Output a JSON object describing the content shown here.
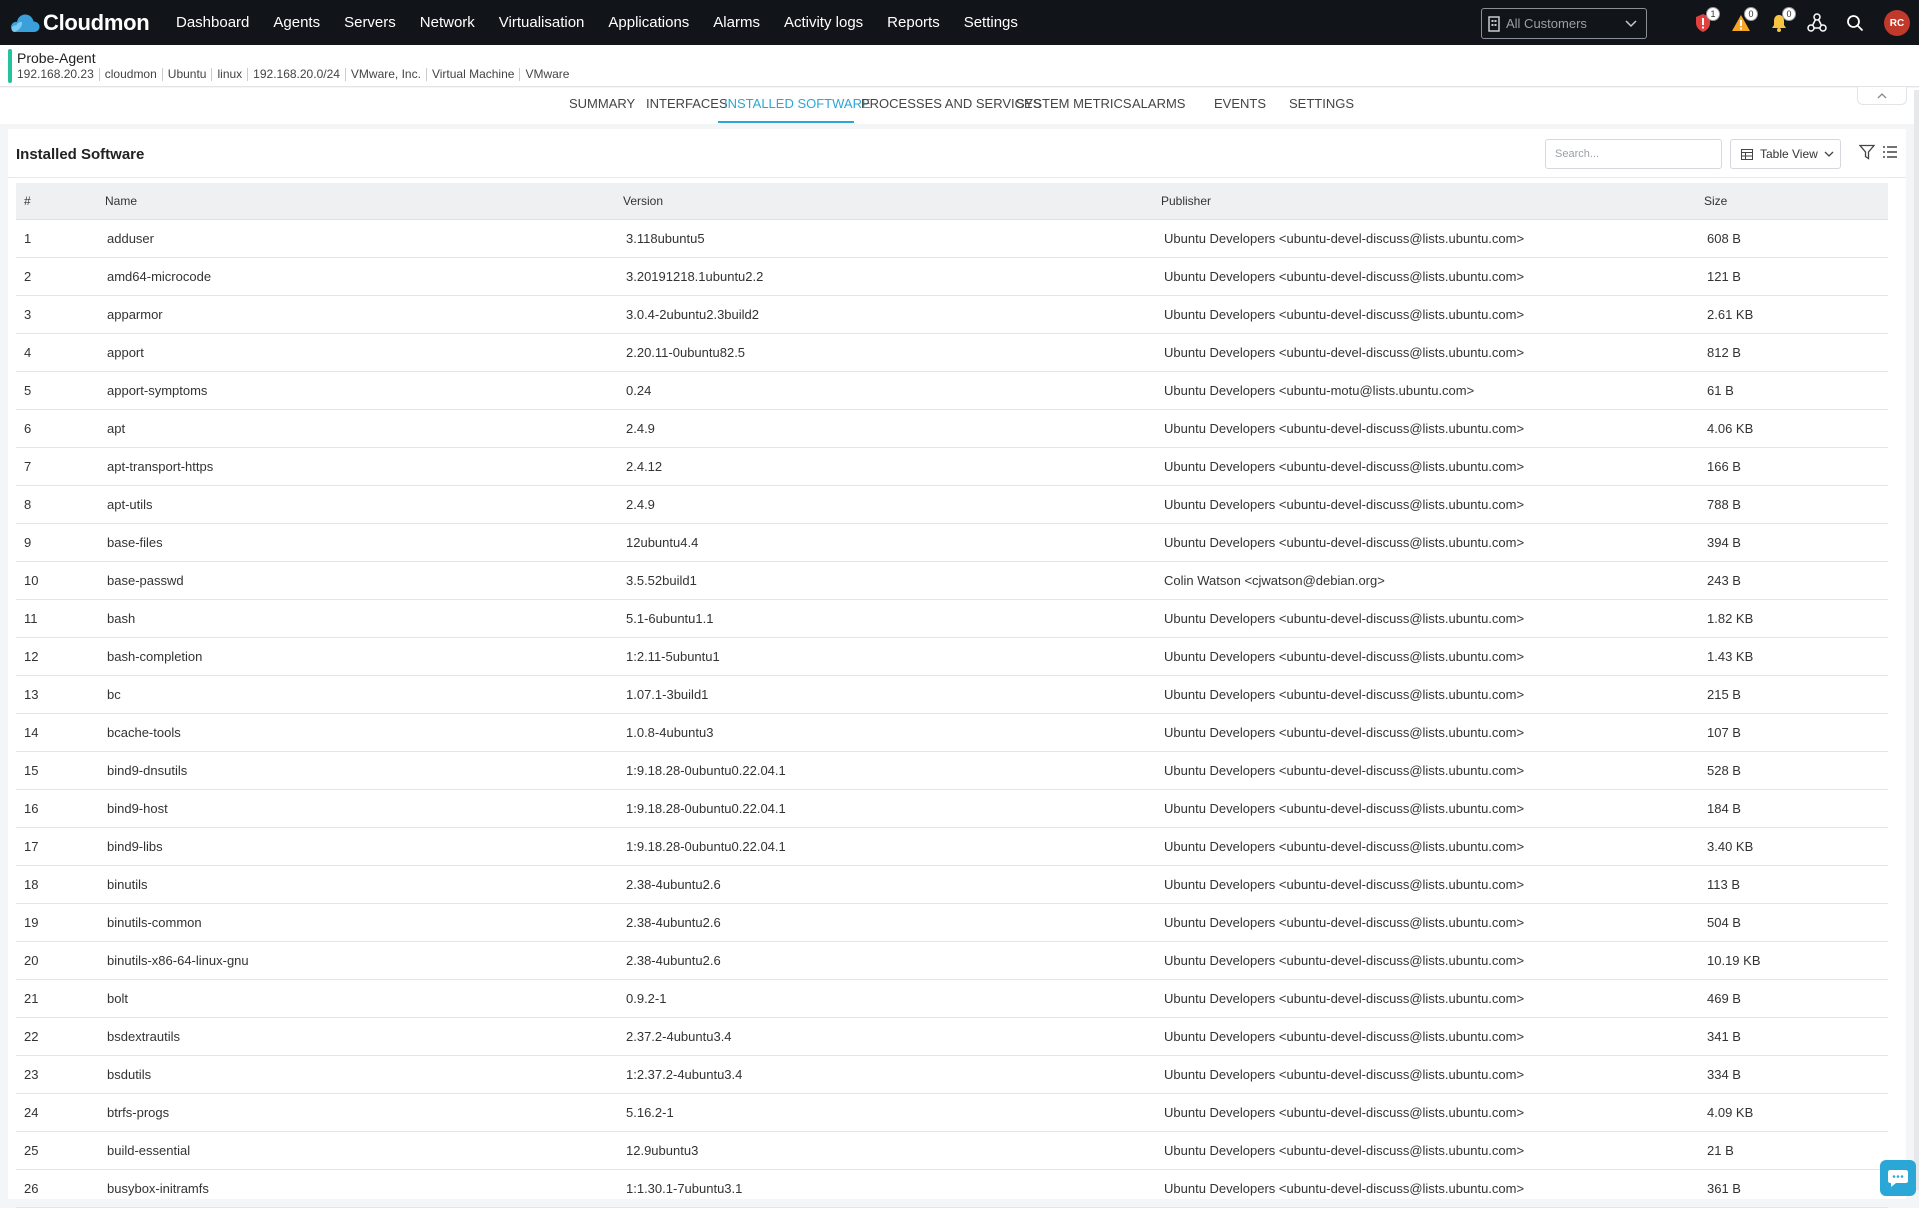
{
  "app": {
    "name": "Cloudmon",
    "nav": [
      "Dashboard",
      "Agents",
      "Servers",
      "Network",
      "Virtualisation",
      "Applications",
      "Alarms",
      "Activity logs",
      "Reports",
      "Settings"
    ],
    "customer_select": "All Customers",
    "badges": {
      "critical": "1",
      "warning": "0",
      "notifications": "0"
    },
    "avatar_initials": "RC"
  },
  "agent": {
    "name": "Probe-Agent",
    "meta": [
      "192.168.20.23",
      "cloudmon",
      "Ubuntu",
      "linux",
      "192.168.20.0/24",
      "VMware, Inc.",
      "Virtual Machine",
      "VMware"
    ]
  },
  "tabs": [
    {
      "label": "SUMMARY",
      "active": false
    },
    {
      "label": "INTERFACES",
      "active": false
    },
    {
      "label": "INSTALLED SOFTWARE",
      "active": true
    },
    {
      "label": "PROCESSES AND SERVICES",
      "active": false
    },
    {
      "label": "SYSTEM METRICS",
      "active": false
    },
    {
      "label": "ALARMS",
      "active": false
    },
    {
      "label": "EVENTS",
      "active": false
    },
    {
      "label": "SETTINGS",
      "active": false
    }
  ],
  "panel": {
    "title": "Installed Software",
    "search_placeholder": "Search...",
    "view_label": "Table View"
  },
  "table": {
    "columns": [
      "#",
      "Name",
      "Version",
      "Publisher",
      "Size"
    ],
    "rows": [
      [
        "1",
        "adduser",
        "3.118ubuntu5",
        "Ubuntu Developers <ubuntu-devel-discuss@lists.ubuntu.com>",
        "608 B"
      ],
      [
        "2",
        "amd64-microcode",
        "3.20191218.1ubuntu2.2",
        "Ubuntu Developers <ubuntu-devel-discuss@lists.ubuntu.com>",
        "121 B"
      ],
      [
        "3",
        "apparmor",
        "3.0.4-2ubuntu2.3build2",
        "Ubuntu Developers <ubuntu-devel-discuss@lists.ubuntu.com>",
        "2.61 KB"
      ],
      [
        "4",
        "apport",
        "2.20.11-0ubuntu82.5",
        "Ubuntu Developers <ubuntu-devel-discuss@lists.ubuntu.com>",
        "812 B"
      ],
      [
        "5",
        "apport-symptoms",
        "0.24",
        "Ubuntu Developers <ubuntu-motu@lists.ubuntu.com>",
        "61 B"
      ],
      [
        "6",
        "apt",
        "2.4.9",
        "Ubuntu Developers <ubuntu-devel-discuss@lists.ubuntu.com>",
        "4.06 KB"
      ],
      [
        "7",
        "apt-transport-https",
        "2.4.12",
        "Ubuntu Developers <ubuntu-devel-discuss@lists.ubuntu.com>",
        "166 B"
      ],
      [
        "8",
        "apt-utils",
        "2.4.9",
        "Ubuntu Developers <ubuntu-devel-discuss@lists.ubuntu.com>",
        "788 B"
      ],
      [
        "9",
        "base-files",
        "12ubuntu4.4",
        "Ubuntu Developers <ubuntu-devel-discuss@lists.ubuntu.com>",
        "394 B"
      ],
      [
        "10",
        "base-passwd",
        "3.5.52build1",
        "Colin Watson <cjwatson@debian.org>",
        "243 B"
      ],
      [
        "11",
        "bash",
        "5.1-6ubuntu1.1",
        "Ubuntu Developers <ubuntu-devel-discuss@lists.ubuntu.com>",
        "1.82 KB"
      ],
      [
        "12",
        "bash-completion",
        "1:2.11-5ubuntu1",
        "Ubuntu Developers <ubuntu-devel-discuss@lists.ubuntu.com>",
        "1.43 KB"
      ],
      [
        "13",
        "bc",
        "1.07.1-3build1",
        "Ubuntu Developers <ubuntu-devel-discuss@lists.ubuntu.com>",
        "215 B"
      ],
      [
        "14",
        "bcache-tools",
        "1.0.8-4ubuntu3",
        "Ubuntu Developers <ubuntu-devel-discuss@lists.ubuntu.com>",
        "107 B"
      ],
      [
        "15",
        "bind9-dnsutils",
        "1:9.18.28-0ubuntu0.22.04.1",
        "Ubuntu Developers <ubuntu-devel-discuss@lists.ubuntu.com>",
        "528 B"
      ],
      [
        "16",
        "bind9-host",
        "1:9.18.28-0ubuntu0.22.04.1",
        "Ubuntu Developers <ubuntu-devel-discuss@lists.ubuntu.com>",
        "184 B"
      ],
      [
        "17",
        "bind9-libs",
        "1:9.18.28-0ubuntu0.22.04.1",
        "Ubuntu Developers <ubuntu-devel-discuss@lists.ubuntu.com>",
        "3.40 KB"
      ],
      [
        "18",
        "binutils",
        "2.38-4ubuntu2.6",
        "Ubuntu Developers <ubuntu-devel-discuss@lists.ubuntu.com>",
        "113 B"
      ],
      [
        "19",
        "binutils-common",
        "2.38-4ubuntu2.6",
        "Ubuntu Developers <ubuntu-devel-discuss@lists.ubuntu.com>",
        "504 B"
      ],
      [
        "20",
        "binutils-x86-64-linux-gnu",
        "2.38-4ubuntu2.6",
        "Ubuntu Developers <ubuntu-devel-discuss@lists.ubuntu.com>",
        "10.19 KB"
      ],
      [
        "21",
        "bolt",
        "0.9.2-1",
        "Ubuntu Developers <ubuntu-devel-discuss@lists.ubuntu.com>",
        "469 B"
      ],
      [
        "22",
        "bsdextrautils",
        "2.37.2-4ubuntu3.4",
        "Ubuntu Developers <ubuntu-devel-discuss@lists.ubuntu.com>",
        "341 B"
      ],
      [
        "23",
        "bsdutils",
        "1:2.37.2-4ubuntu3.4",
        "Ubuntu Developers <ubuntu-devel-discuss@lists.ubuntu.com>",
        "334 B"
      ],
      [
        "24",
        "btrfs-progs",
        "5.16.2-1",
        "Ubuntu Developers <ubuntu-devel-discuss@lists.ubuntu.com>",
        "4.09 KB"
      ],
      [
        "25",
        "build-essential",
        "12.9ubuntu3",
        "Ubuntu Developers <ubuntu-devel-discuss@lists.ubuntu.com>",
        "21 B"
      ],
      [
        "26",
        "busybox-initramfs",
        "1:1.30.1-7ubuntu3.1",
        "Ubuntu Developers <ubuntu-devel-discuss@lists.ubuntu.com>",
        "361 B"
      ]
    ]
  },
  "colors": {
    "accent": "#2aa7d6",
    "topbar": "#111418",
    "agent_status": "#25c2a0"
  }
}
